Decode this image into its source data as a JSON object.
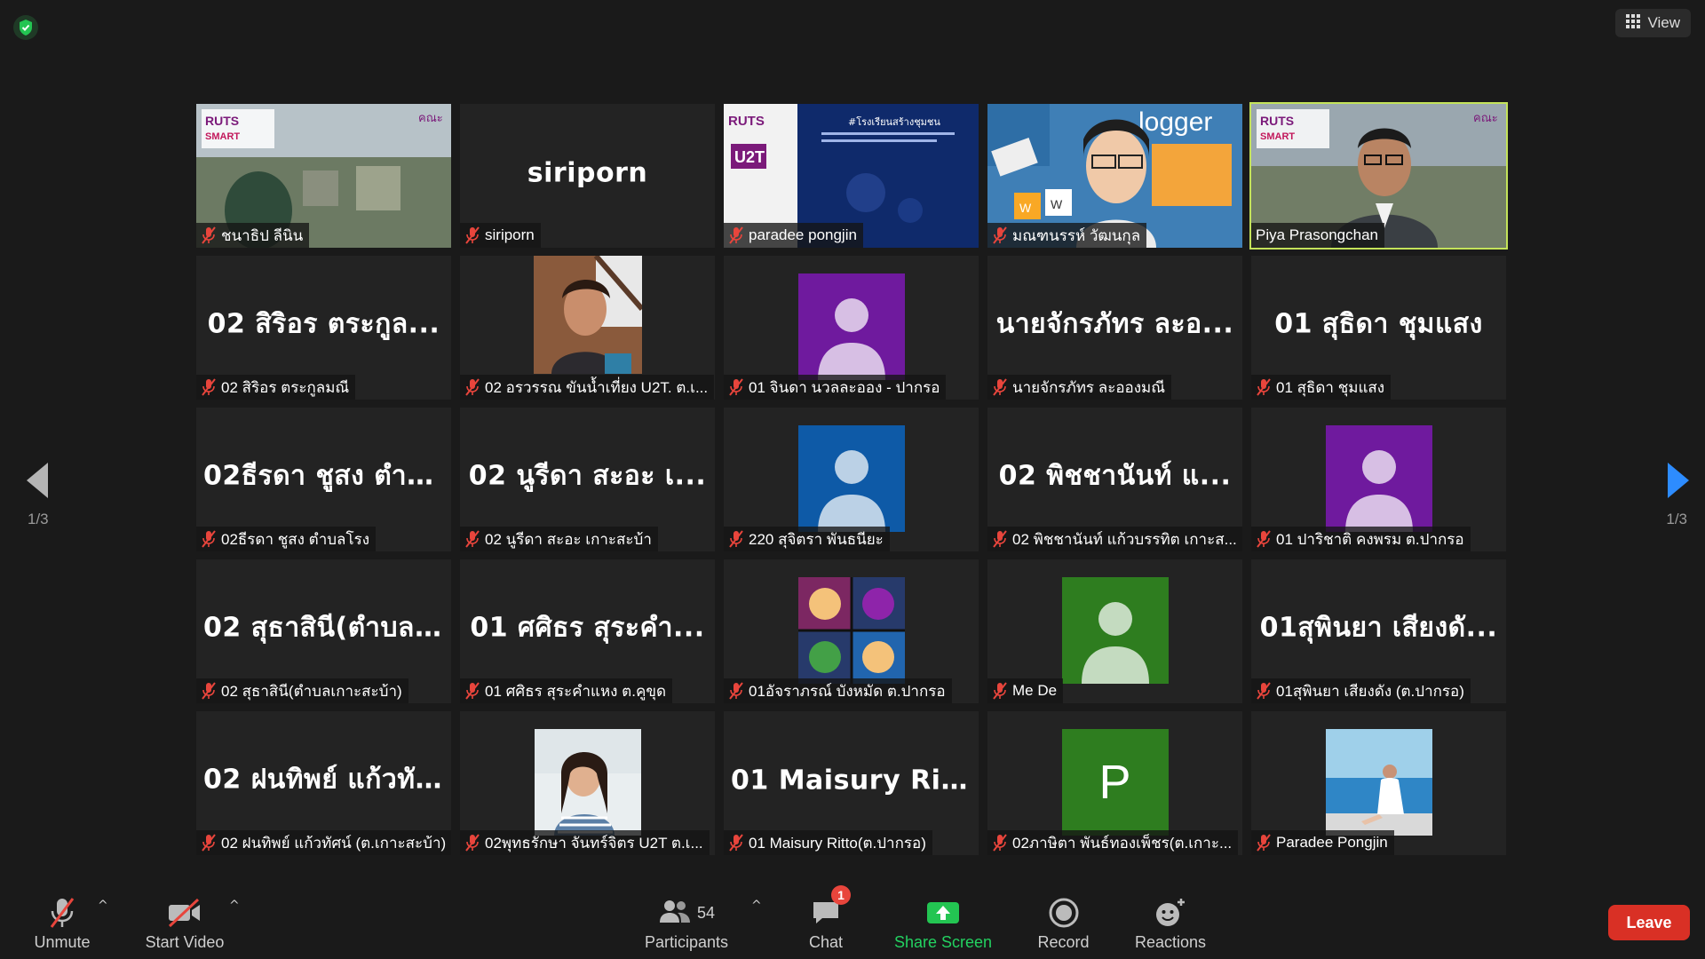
{
  "top": {
    "view_label": "View"
  },
  "pager": {
    "left": "1/3",
    "right": "1/3"
  },
  "tiles": [
    {
      "kind": "video-ruts",
      "name": "ชนาธิป ลีนิน"
    },
    {
      "kind": "text",
      "big": "siriporn",
      "name": "siriporn"
    },
    {
      "kind": "video-slide",
      "name": "paradee pongjin"
    },
    {
      "kind": "video-woman",
      "name": "มณฑนรรห์ วัฒนกุล"
    },
    {
      "kind": "video-man",
      "name": "Piya Prasongchan",
      "active": true
    },
    {
      "kind": "text",
      "big": "02 สิริอร ตระกูล...",
      "name": "02 สิริอร ตระกูลมณี"
    },
    {
      "kind": "photo-boy",
      "name": "02 อรวรรณ ขันน้ำเที่ยง U2T. ต.เ..."
    },
    {
      "kind": "avatar",
      "color": "#6f1a9e",
      "name": "01 จินดา นวลละออง - ปากรอ"
    },
    {
      "kind": "text",
      "big": "นายจักรภัทร ละอ...",
      "name": "นายจักรภัทร ละอองมณี"
    },
    {
      "kind": "text",
      "big": "01 สุธิดา ชุมแสง",
      "name": "01 สุธิดา ชุมแสง"
    },
    {
      "kind": "text",
      "big": "02ธีรดา ชูสง ตำบ...",
      "name": "02ธีรดา ชูสง ตำบลโรง"
    },
    {
      "kind": "text",
      "big": "02 นูรีดา สะอะ เ...",
      "name": "02 นูรีดา สะอะ เกาะสะบ้า"
    },
    {
      "kind": "avatar",
      "color": "#0e5aa7",
      "name": "220 สุจิตรา พันธนียะ"
    },
    {
      "kind": "text",
      "big": "02 พิชชานันท์ แ...",
      "name": "02 พิชชานันท์ แก้วบรรทิต เกาะส..."
    },
    {
      "kind": "avatar",
      "color": "#6f1a9e",
      "name": "01 ปาริชาติ คงพรม  ต.ปากรอ"
    },
    {
      "kind": "text",
      "big": "02 สุธาสินี(ตำบล...",
      "name": "02 สุธาสินี(ตำบลเกาะสะบ้า)"
    },
    {
      "kind": "text",
      "big": "01 ศศิธร สุระคำ...",
      "name": "01 ศศิธร สุระคำแหง ต.คูขุด"
    },
    {
      "kind": "photo-pattern",
      "name": "01อัจราภรณ์ บังหมัด ต.ปากรอ"
    },
    {
      "kind": "avatar",
      "color": "#2e7d1f",
      "name": "Me De"
    },
    {
      "kind": "text",
      "big": "01สุพินยา เสียงดั...",
      "name": "01สุพินยา เสียงดัง (ต.ปากรอ)"
    },
    {
      "kind": "text",
      "big": "02 ฝนทิพย์ แก้วทั...",
      "name": "02 ฝนทิพย์ แก้วทัศน์ (ต.เกาะสะบ้า)"
    },
    {
      "kind": "photo-girl",
      "name": "02พุทธรักษา จันทร์จิตร U2T  ต.เ..."
    },
    {
      "kind": "text",
      "big": "01 Maisury Ritt...",
      "name": "01 Maisury Ritto(ต.ปากรอ)"
    },
    {
      "kind": "letter",
      "letter": "P",
      "color": "#2e7d1f",
      "name": "02ภาษิตา  พันธ์ทองเพ็ชร(ต.เกาะ..."
    },
    {
      "kind": "photo-sea",
      "name": "Paradee Pongjin"
    }
  ],
  "toolbar": {
    "unmute": "Unmute",
    "start_video": "Start Video",
    "participants": "Participants",
    "participants_count": "54",
    "chat": "Chat",
    "chat_badge": "1",
    "share_screen": "Share Screen",
    "record": "Record",
    "reactions": "Reactions",
    "leave": "Leave"
  }
}
